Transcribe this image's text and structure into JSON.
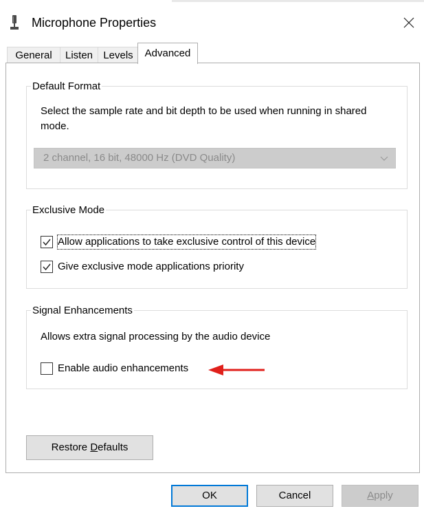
{
  "window": {
    "title": "Microphone Properties",
    "icon": "microphone-icon",
    "close_icon": "close-icon"
  },
  "tabs": [
    {
      "label": "General",
      "active": false
    },
    {
      "label": "Listen",
      "active": false
    },
    {
      "label": "Levels",
      "active": false
    },
    {
      "label": "Advanced",
      "active": true
    }
  ],
  "default_format": {
    "legend": "Default Format",
    "description": "Select the sample rate and bit depth to be used when running in shared mode.",
    "selected": "2 channel, 16 bit, 48000 Hz (DVD Quality)",
    "enabled": false
  },
  "exclusive_mode": {
    "legend": "Exclusive Mode",
    "options": [
      {
        "label": "Allow applications to take exclusive control of this device",
        "checked": true
      },
      {
        "label": "Give exclusive mode applications priority",
        "checked": true
      }
    ]
  },
  "signal_enhancements": {
    "legend": "Signal Enhancements",
    "description": "Allows extra signal processing by the audio device",
    "option": {
      "label": "Enable audio enhancements",
      "checked": false
    }
  },
  "annotation": {
    "arrow_color": "#e0201b"
  },
  "buttons": {
    "restore_pre": "Restore ",
    "restore_accel": "D",
    "restore_post": "efaults",
    "ok": "OK",
    "cancel": "Cancel",
    "apply_accel": "A",
    "apply_post": "pply"
  },
  "colors": {
    "accent": "#0078d7",
    "disabled_bg": "#cccccc",
    "disabled_text": "#8a8a8a"
  }
}
